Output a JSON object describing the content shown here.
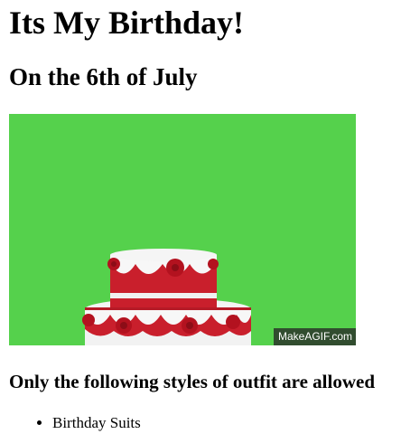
{
  "page": {
    "title": "Its My Birthday!",
    "subtitle": "On the 6th of July"
  },
  "gif": {
    "watermark": "MakeAGIF.com",
    "background_color": "#55d14c",
    "subject": "cake-illustration"
  },
  "outfits": {
    "heading": "Only the following styles of outfit are allowed",
    "items": [
      {
        "label": "Birthday Suits"
      }
    ]
  }
}
